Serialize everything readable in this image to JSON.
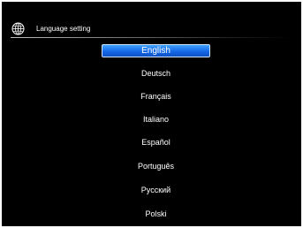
{
  "header": {
    "title": "Language setting",
    "icon": "globe-icon"
  },
  "languages": [
    {
      "label": "English",
      "selected": true
    },
    {
      "label": "Deutsch",
      "selected": false
    },
    {
      "label": "Français",
      "selected": false
    },
    {
      "label": "Italiano",
      "selected": false
    },
    {
      "label": "Español",
      "selected": false
    },
    {
      "label": "Português",
      "selected": false
    },
    {
      "label": "Русский",
      "selected": false
    },
    {
      "label": "Polski",
      "selected": false
    }
  ],
  "colors": {
    "background": "#000000",
    "text": "#ffffff",
    "selection": "#1a73f0"
  }
}
